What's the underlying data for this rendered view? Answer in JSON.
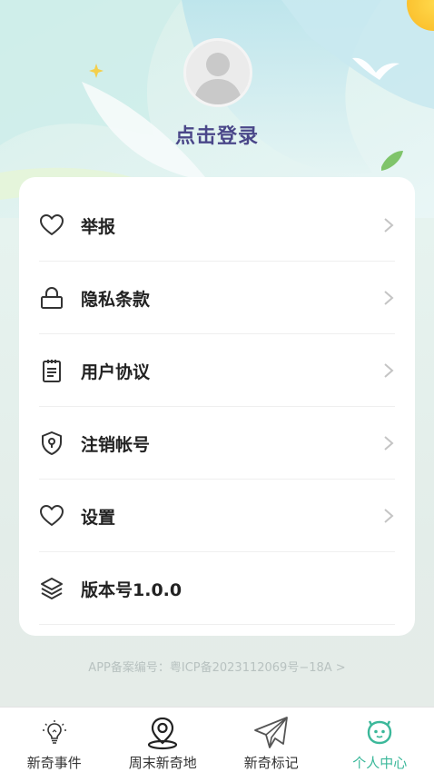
{
  "header": {
    "login_text": "点击登录"
  },
  "menu": [
    {
      "label": "举报",
      "icon": "heart-icon",
      "has_chevron": true
    },
    {
      "label": "隐私条款",
      "icon": "lock-icon",
      "has_chevron": true
    },
    {
      "label": "用户协议",
      "icon": "document-icon",
      "has_chevron": true
    },
    {
      "label": "注销帐号",
      "icon": "shield-icon",
      "has_chevron": true
    },
    {
      "label": "设置",
      "icon": "heart-icon",
      "has_chevron": true
    },
    {
      "label": "版本号1.0.0",
      "icon": "layers-icon",
      "has_chevron": false
    }
  ],
  "icp_text": "APP备案编号：粤ICP备2023112069号−18A >",
  "tabs": [
    {
      "label": "新奇事件",
      "icon": "lightbulb-icon",
      "active": false
    },
    {
      "label": "周末新奇地",
      "icon": "map-pin-icon",
      "active": false
    },
    {
      "label": "新奇标记",
      "icon": "paper-plane-icon",
      "active": false
    },
    {
      "label": "个人中心",
      "icon": "smiley-face-icon",
      "active": true
    }
  ],
  "colors": {
    "accent": "#3bb89a",
    "login_text": "#4a4789"
  }
}
